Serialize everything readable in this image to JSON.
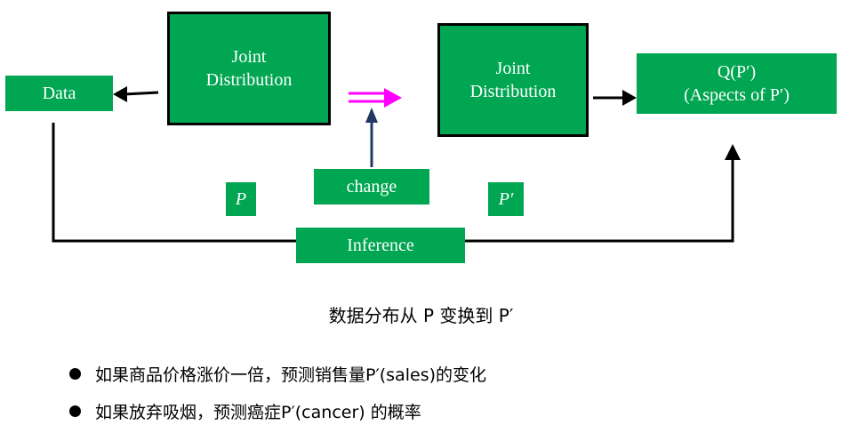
{
  "diagram": {
    "data_label": "Data",
    "joint_left_label": "Joint\nDistribution",
    "joint_right_label": "Joint\nDistribution",
    "q_label": "Q(P′)\n(Aspects of P′)",
    "change_label": "change",
    "p_label": "P",
    "p_prime_label": "P′",
    "inference_label": "Inference"
  },
  "caption": "数据分布从 P 变换到 P′",
  "bullets": [
    "如果商品价格涨价一倍，预测销售量P′(sales)的变化",
    "如果放弃吸烟，预测癌症P′(cancer) 的概率"
  ],
  "colors": {
    "box_green": "#00a651",
    "magenta_arrow": "#ff00ff",
    "change_arrow": "#1f3864"
  }
}
